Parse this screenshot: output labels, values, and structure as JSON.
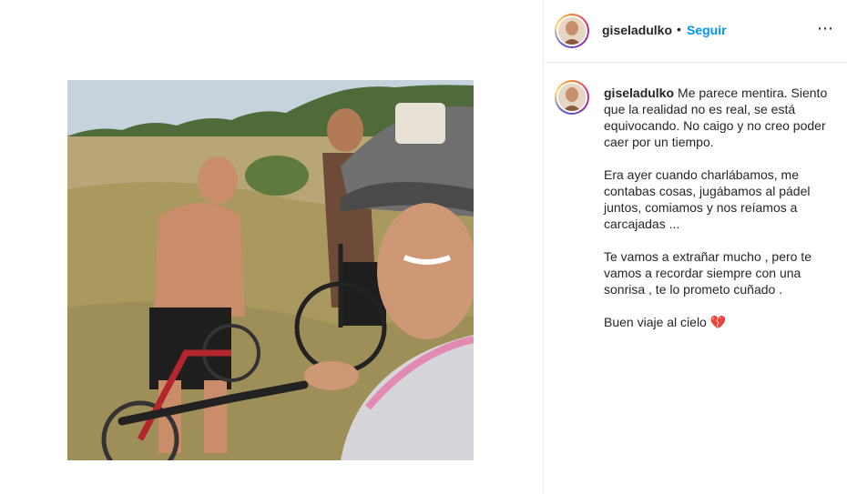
{
  "post": {
    "username": "giseladulko",
    "follow_label": "Seguir",
    "separator": "•",
    "more_icon": "⋯",
    "caption": {
      "p1": "Me parece mentira. Siento que la realidad no es real, se está equivocando. No caigo y no creo poder caer por un tiempo.",
      "p2": "Era ayer cuando charlábamos, me contabas cosas, jugábamos al pádel juntos, comiamos y nos reíamos a carcajadas ...",
      "p3": "Te vamos a extrañar mucho , pero te vamos a recordar siempre con una sonrisa , te lo prometo cuñado .",
      "p4": "Buen viaje al cielo",
      "emoji": "💔"
    }
  },
  "colors": {
    "link_blue": "#0095f6",
    "text": "#262626",
    "divider": "#efefef"
  }
}
